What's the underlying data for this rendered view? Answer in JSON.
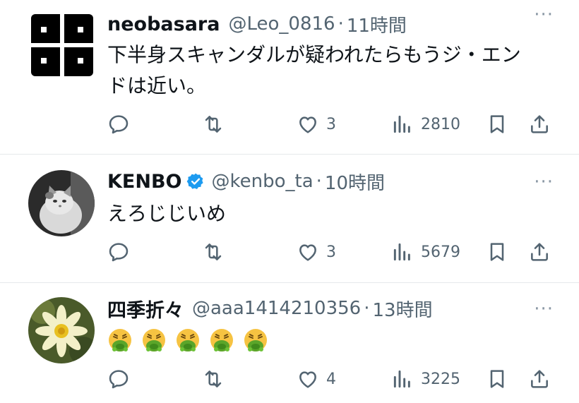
{
  "tweets": [
    {
      "name": "neobasara",
      "handle": "@Leo_0816",
      "dot": "·",
      "time": "11時間",
      "text_lines": [
        "下半身スキャンダルが疑われたらもうジ・エン",
        "ドは近い。"
      ],
      "verified": false,
      "avatar": "neobasara-logo",
      "actions": {
        "reply": "",
        "retweet": "",
        "like": "3",
        "views": "2810"
      }
    },
    {
      "name": "KENBO",
      "handle": "@kenbo_ta",
      "dot": "·",
      "time": "10時間",
      "text_lines": [
        "えろじじいめ"
      ],
      "verified": true,
      "avatar": "cat-photo",
      "actions": {
        "reply": "",
        "retweet": "",
        "like": "3",
        "views": "5679"
      }
    },
    {
      "name": "四季折々",
      "handle": "@aaa1414210356",
      "dot": "·",
      "time": "13時間",
      "text_lines": [
        ""
      ],
      "emojis": [
        "nauseated-face-emoji",
        "nauseated-face-emoji",
        "nauseated-face-emoji",
        "nauseated-face-emoji",
        "nauseated-face-emoji"
      ],
      "verified": false,
      "avatar": "water-lily-photo",
      "actions": {
        "reply": "",
        "retweet": "",
        "like": "4",
        "views": "3225"
      }
    }
  ],
  "more_label": "···",
  "colors": {
    "verified_blue": "#1d9bf0",
    "secondary_text": "#536471",
    "icon_gray": "#536471"
  }
}
